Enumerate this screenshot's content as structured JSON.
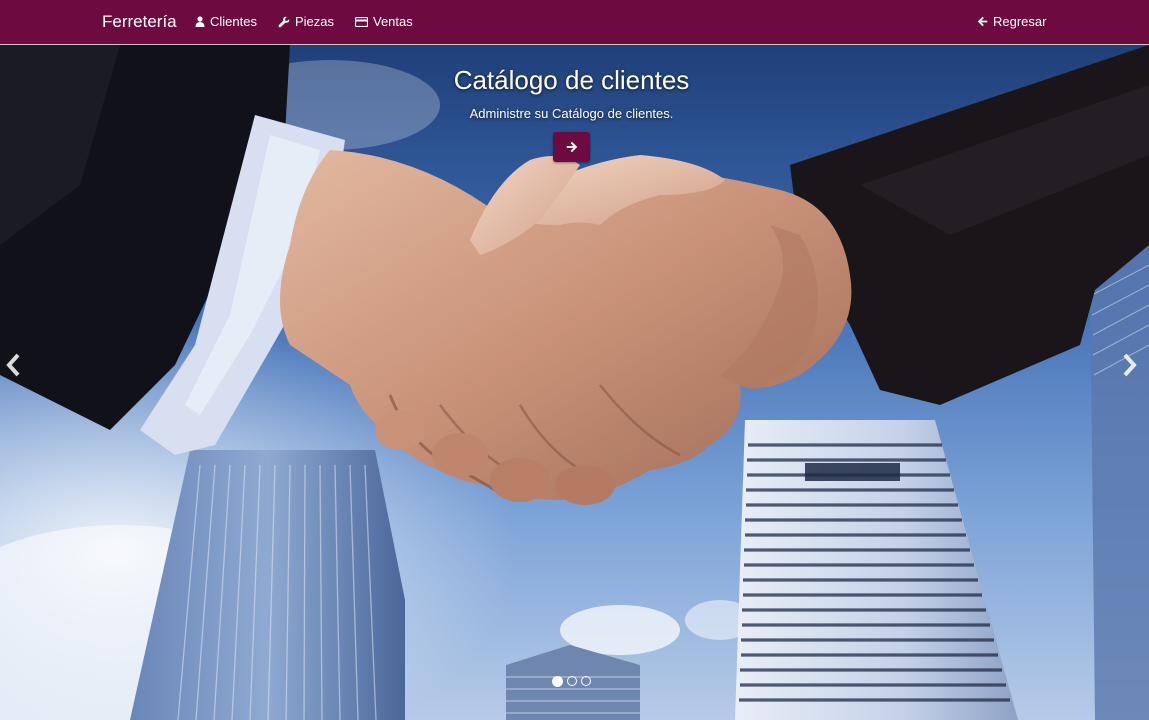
{
  "navbar": {
    "brand": "Ferretería",
    "items": [
      {
        "label": "Clientes",
        "icon": "user-icon"
      },
      {
        "label": "Piezas",
        "icon": "wrench-icon"
      },
      {
        "label": "Ventas",
        "icon": "credit-card-icon"
      }
    ],
    "back": {
      "label": "Regresar",
      "icon": "arrow-left-icon"
    }
  },
  "carousel": {
    "title": "Catálogo de clientes",
    "subtitle": "Administre su Catálogo de clientes.",
    "button_icon": "arrow-right-icon",
    "slides_count": 3,
    "active_slide": 1
  },
  "colors": {
    "brand": "#6d0a40",
    "sky": "#3d6cb2"
  }
}
